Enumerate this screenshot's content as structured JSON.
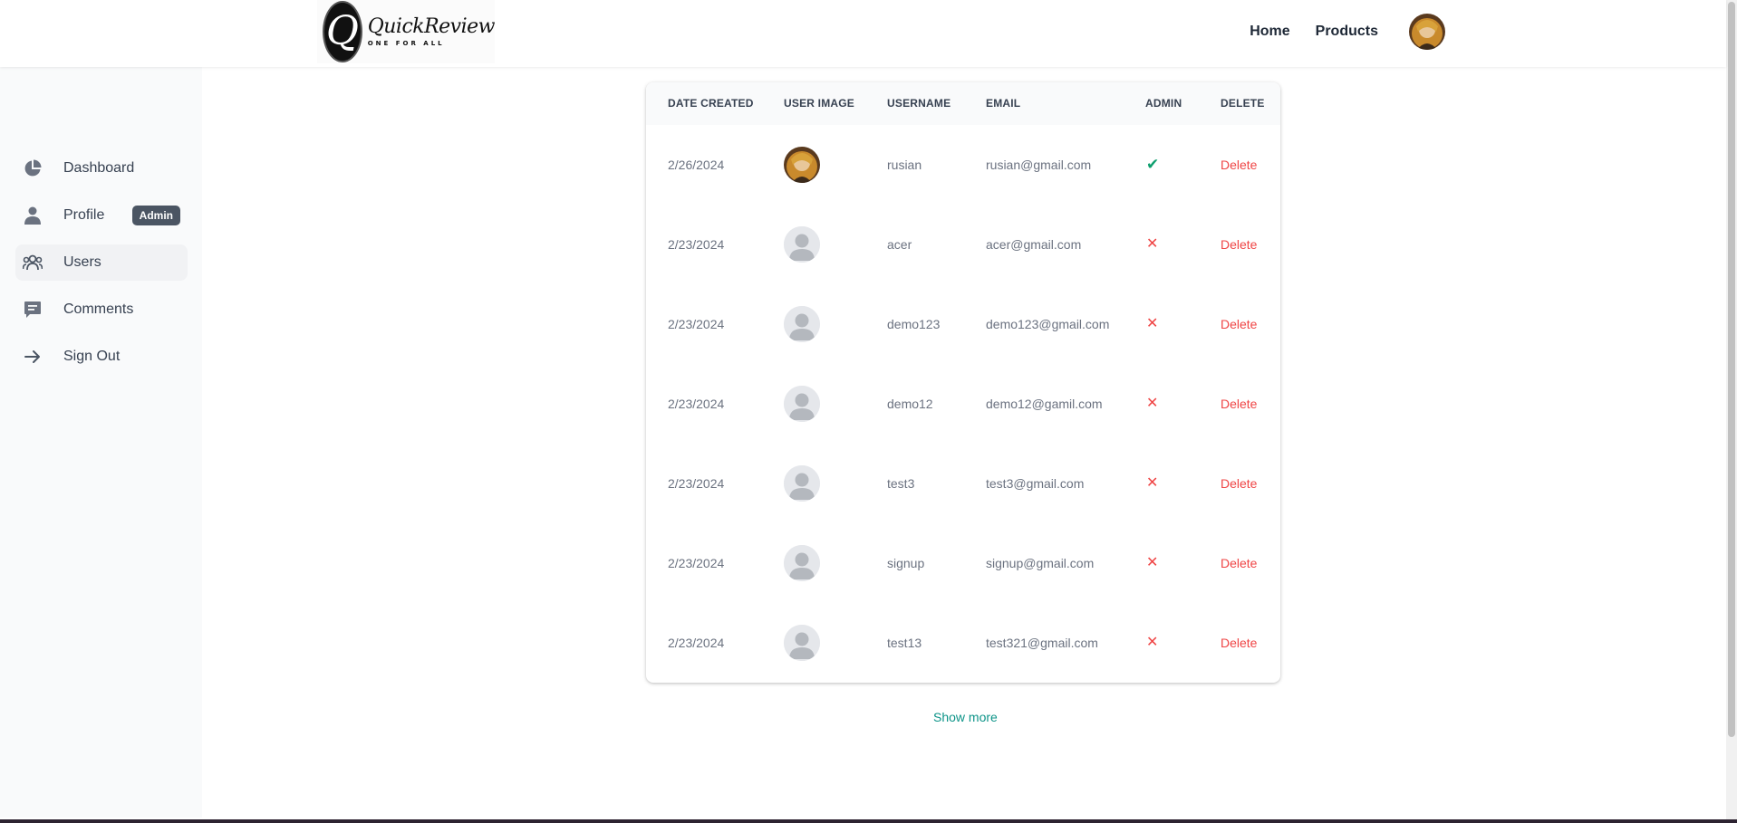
{
  "header": {
    "logo_letter": "Q",
    "logo_name": "QuickReview",
    "logo_tagline": "ONE FOR ALL",
    "nav": [
      {
        "label": "Home"
      },
      {
        "label": "Products"
      }
    ]
  },
  "sidebar": {
    "items": [
      {
        "label": "Dashboard",
        "icon": "pie-chart-icon"
      },
      {
        "label": "Profile",
        "icon": "user-icon",
        "badge": "Admin"
      },
      {
        "label": "Users",
        "icon": "users-icon",
        "active": true
      },
      {
        "label": "Comments",
        "icon": "comment-icon"
      },
      {
        "label": "Sign Out",
        "icon": "arrow-right-icon"
      }
    ]
  },
  "table": {
    "headers": [
      "DATE CREATED",
      "USER IMAGE",
      "USERNAME",
      "EMAIL",
      "ADMIN",
      "DELETE"
    ],
    "rows": [
      {
        "date": "2/26/2024",
        "image": "custom-avatar",
        "username": "rusian",
        "email": "rusian@gmail.com",
        "admin": true,
        "delete": "Delete"
      },
      {
        "date": "2/23/2024",
        "image": "default-avatar",
        "username": "acer",
        "email": "acer@gmail.com",
        "admin": false,
        "delete": "Delete"
      },
      {
        "date": "2/23/2024",
        "image": "default-avatar",
        "username": "demo123",
        "email": "demo123@gmail.com",
        "admin": false,
        "delete": "Delete"
      },
      {
        "date": "2/23/2024",
        "image": "default-avatar",
        "username": "demo12",
        "email": "demo12@gamil.com",
        "admin": false,
        "delete": "Delete"
      },
      {
        "date": "2/23/2024",
        "image": "default-avatar",
        "username": "test3",
        "email": "test3@gmail.com",
        "admin": false,
        "delete": "Delete"
      },
      {
        "date": "2/23/2024",
        "image": "default-avatar",
        "username": "signup",
        "email": "signup@gmail.com",
        "admin": false,
        "delete": "Delete"
      },
      {
        "date": "2/23/2024",
        "image": "default-avatar",
        "username": "test13",
        "email": "test321@gmail.com",
        "admin": false,
        "delete": "Delete"
      }
    ],
    "admin_true_symbol": "✔",
    "admin_false_symbol": "✕"
  },
  "show_more": "Show more",
  "colors": {
    "accent": "#0d9488",
    "danger": "#ef4444",
    "success": "#0e9f6e",
    "badge": "#4b5563"
  }
}
